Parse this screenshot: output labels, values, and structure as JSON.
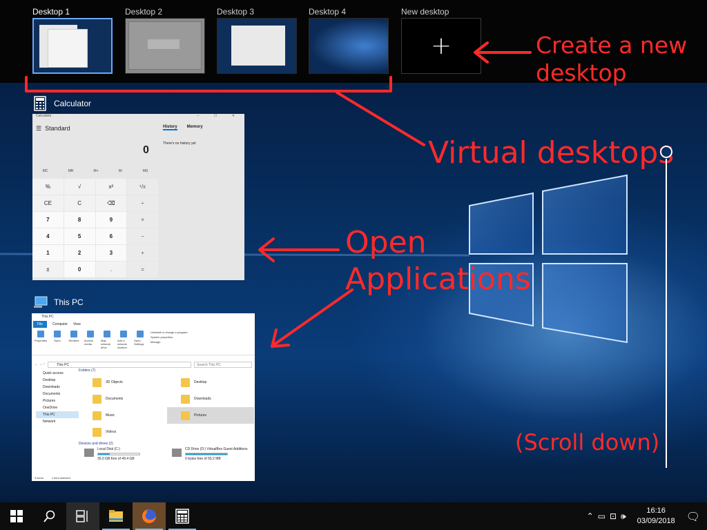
{
  "desktops": [
    {
      "label": "Desktop 1",
      "active": true
    },
    {
      "label": "Desktop 2",
      "active": false
    },
    {
      "label": "Desktop 3",
      "active": false
    },
    {
      "label": "Desktop 4",
      "active": false
    }
  ],
  "new_desktop": {
    "label": "New desktop",
    "icon": "plus-icon"
  },
  "windows": {
    "calculator": {
      "title": "Calculator",
      "titlebar": "Calculator",
      "mode": "Standard",
      "history_tab": "History",
      "memory_tab": "Memory",
      "no_history": "There's no history yet",
      "display": "0",
      "memory_keys": [
        "MC",
        "MR",
        "M+",
        "M-",
        "MS"
      ],
      "keys": [
        "%",
        "√",
        "x²",
        "¹/x",
        "CE",
        "C",
        "⌫",
        "÷",
        "7",
        "8",
        "9",
        "×",
        "4",
        "5",
        "6",
        "−",
        "1",
        "2",
        "3",
        "+",
        "±",
        "0",
        ".",
        "="
      ]
    },
    "this_pc": {
      "title": "This PC",
      "titlebar": "This PC",
      "tabs": [
        "File",
        "Computer",
        "View"
      ],
      "ribbon": [
        "Properties",
        "Open",
        "Rename",
        "Access media",
        "Map network drive",
        "Add a network location",
        "Open Settings",
        "Uninstall or change a program",
        "System properties",
        "Manage"
      ],
      "address": "This PC",
      "search_placeholder": "Search This PC",
      "nav": [
        "Quick access",
        "Desktop",
        "Downloads",
        "Documents",
        "Pictures",
        "OneDrive",
        "This PC",
        "Network"
      ],
      "folders_header": "Folders (7)",
      "folders": [
        "3D Objects",
        "Desktop",
        "Documents",
        "Downloads",
        "Music",
        "Pictures",
        "Videos"
      ],
      "drives_header": "Devices and drives (2)",
      "drives": [
        {
          "name": "Local Disk (C:)",
          "detail": "35.0 GB free of 49.4 GB",
          "used_fraction": 0.29
        },
        {
          "name": "CD Drive (D:) VirtualBox Guest Additions",
          "detail": "0 bytes free of 55.2 MB",
          "used_fraction": 1.0
        }
      ],
      "status_items": "9 items",
      "status_selected": "1 item selected"
    }
  },
  "annotations": {
    "new_desktop": "Create a new desktop",
    "virtual_desktops": "Virtual desktops",
    "open_apps": "Open Applications",
    "scroll": "(Scroll down)",
    "color": "#ff2a2a"
  },
  "taskbar": {
    "icons": [
      "windows-start-icon",
      "search-icon",
      "task-view-icon",
      "file-explorer-icon",
      "firefox-icon",
      "calculator-icon"
    ],
    "time": "16:16",
    "date": "03/09/2018"
  }
}
